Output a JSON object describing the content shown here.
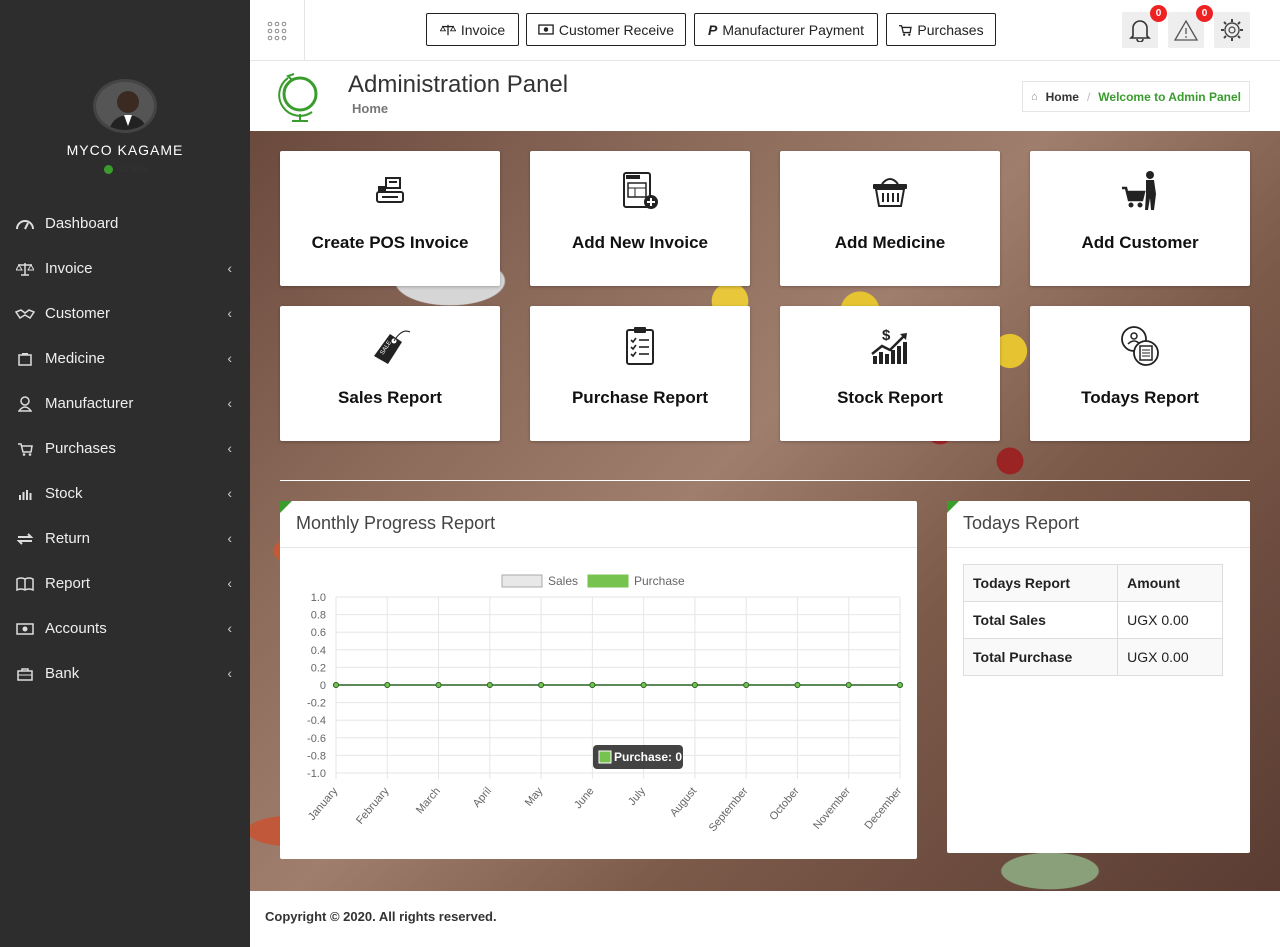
{
  "user": {
    "name": "MYCO KAGAME",
    "status": "Online"
  },
  "sidebar": {
    "items": [
      {
        "label": "Dashboard",
        "icon": "dashboard-icon",
        "arrow": ""
      },
      {
        "label": "Invoice",
        "icon": "balance-scale-icon",
        "arrow": "‹"
      },
      {
        "label": "Customer",
        "icon": "handshake-icon",
        "arrow": "‹"
      },
      {
        "label": "Medicine",
        "icon": "medicine-box-icon",
        "arrow": "‹"
      },
      {
        "label": "Manufacturer",
        "icon": "user-icon",
        "arrow": "‹"
      },
      {
        "label": "Purchases",
        "icon": "cart-icon",
        "arrow": "‹"
      },
      {
        "label": "Stock",
        "icon": "bar-chart-icon",
        "arrow": "‹"
      },
      {
        "label": "Return",
        "icon": "exchange-icon",
        "arrow": "‹"
      },
      {
        "label": "Report",
        "icon": "book-icon",
        "arrow": "‹"
      },
      {
        "label": "Accounts",
        "icon": "money-icon",
        "arrow": "‹"
      },
      {
        "label": "Bank",
        "icon": "bank-icon",
        "arrow": "‹"
      }
    ]
  },
  "topbar": {
    "buttons": [
      "Invoice",
      "Customer Receive",
      "Manufacturer Payment",
      "Purchases"
    ],
    "notifications_count": "0",
    "alerts_count": "0"
  },
  "header": {
    "title": "Administration Panel",
    "subtitle": "Home",
    "breadcrumb_home": "Home",
    "breadcrumb_current": "Welcome to Admin Panel"
  },
  "cards": [
    "Create POS Invoice",
    "Add New Invoice",
    "Add Medicine",
    "Add Customer",
    "Sales Report",
    "Purchase Report",
    "Stock Report",
    "Todays Report"
  ],
  "monthly_panel": {
    "title": "Monthly Progress Report",
    "tooltip": "Purchase: 0"
  },
  "chart_data": {
    "type": "line",
    "categories": [
      "January",
      "February",
      "March",
      "April",
      "May",
      "June",
      "July",
      "August",
      "September",
      "October",
      "November",
      "December"
    ],
    "series": [
      {
        "name": "Sales",
        "values": [
          0,
          0,
          0,
          0,
          0,
          0,
          0,
          0,
          0,
          0,
          0,
          0
        ],
        "color": "#e8e8e8"
      },
      {
        "name": "Purchase",
        "values": [
          0,
          0,
          0,
          0,
          0,
          0,
          0,
          0,
          0,
          0,
          0,
          0
        ],
        "color": "#76c34f"
      }
    ],
    "yticks": [
      "1.0",
      "0.8",
      "0.6",
      "0.4",
      "0.2",
      "0",
      "-0.2",
      "-0.4",
      "-0.6",
      "-0.8",
      "-1.0"
    ],
    "ylim": [
      -1.0,
      1.0
    ],
    "legend": "top-center",
    "grid": true
  },
  "todays_panel": {
    "title": "Todays Report",
    "headers": [
      "Todays Report",
      "Amount"
    ],
    "rows": [
      {
        "label": "Total Sales",
        "amount": "UGX 0.00"
      },
      {
        "label": "Total Purchase",
        "amount": "UGX 0.00"
      }
    ]
  },
  "footer": {
    "text": "Copyright © 2020. All rights reserved."
  },
  "colors": {
    "accent": "#3a9c2d",
    "sidebar_bg": "#2d2d2d",
    "badge": "#e22222"
  }
}
